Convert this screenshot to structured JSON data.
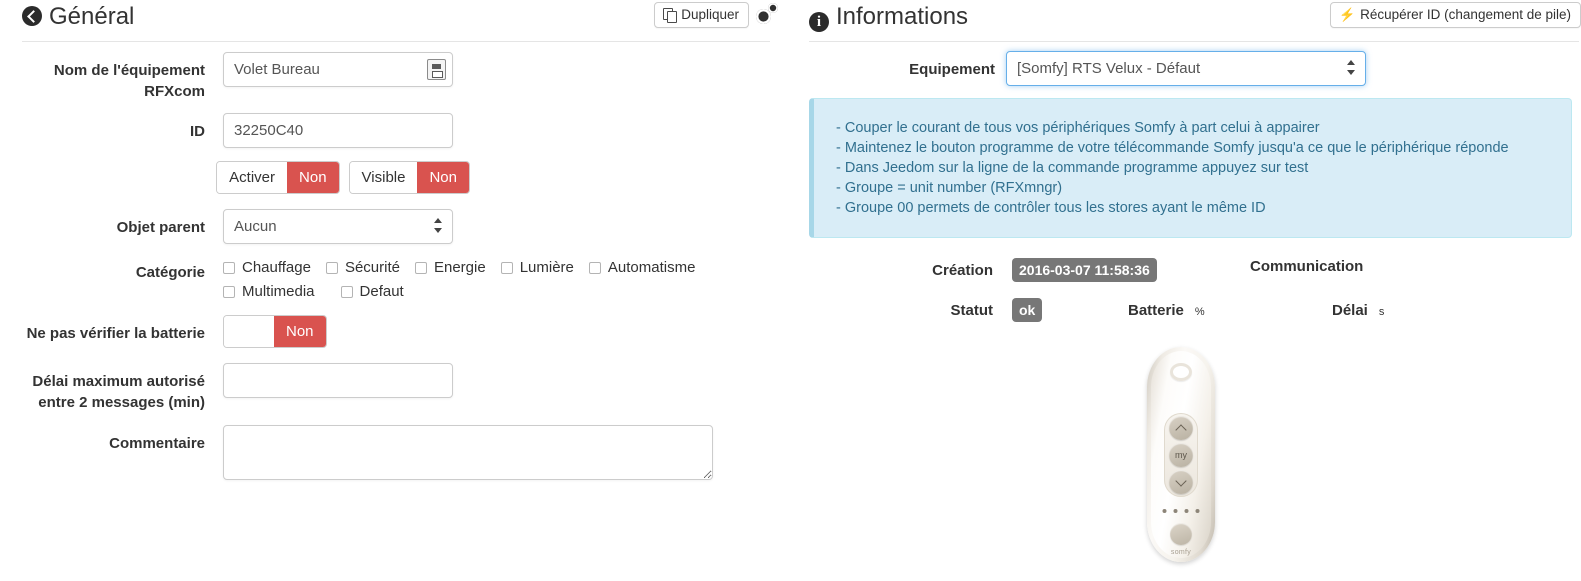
{
  "left_panel": {
    "title": "Général",
    "back_icon": "back-arrow-icon",
    "duplicate_button": "Dupliquer",
    "duplicate_icon": "copy-icon",
    "config_icon": "gears-icon",
    "fields": {
      "name_label": "Nom de l'équipement RFXcom",
      "name_label_line1": "Nom de l'équipement",
      "name_label_line2": "RFXcom",
      "name_value": "Volet Bureau",
      "name_inline_icon": "battery-picker-icon",
      "id_label": "ID",
      "id_value": "32250C40",
      "parent_label": "Objet parent",
      "parent_value": "Aucun",
      "category_label": "Catégorie",
      "battery_check_label": "Ne pas vérifier la batterie",
      "delay_label_line1": "Délai maximum autorisé",
      "delay_label_line2": "entre 2 messages (min)",
      "delay_value": "",
      "comment_label": "Commentaire",
      "comment_value": ""
    },
    "toggles": [
      {
        "name": "activer",
        "label": "Activer",
        "state": "Non"
      },
      {
        "name": "visible",
        "label": "Visible",
        "state": "Non"
      }
    ],
    "battery_toggle": {
      "label": "",
      "state": "Non"
    },
    "categories": [
      {
        "label": "Chauffage",
        "checked": false
      },
      {
        "label": "Sécurité",
        "checked": false
      },
      {
        "label": "Energie",
        "checked": false
      },
      {
        "label": "Lumière",
        "checked": false
      },
      {
        "label": "Automatisme",
        "checked": false
      },
      {
        "label": "Multimedia",
        "checked": false
      },
      {
        "label": "Defaut",
        "checked": false
      }
    ]
  },
  "right_panel": {
    "title": "Informations",
    "info_icon": "info-circle-icon",
    "recover_button": "Récupérer ID (changement de pile)",
    "recover_icon": "bolt-icon",
    "equipment_label": "Equipement",
    "equipment_value": "[Somfy] RTS Velux - Défaut",
    "alert_lines": [
      "- Couper le courant de tous vos périphériques Somfy à part celui à appairer",
      "- Maintenez le bouton programme de votre télécommande Somfy jusqu'a ce que le périphérique réponde",
      "- Dans Jeedom sur la ligne de la commande programme appuyez sur test",
      "- Groupe = unit number (RFXmngr)",
      "- Groupe 00 permets de contrôler tous les stores ayant le même ID"
    ],
    "status": {
      "creation_label": "Création",
      "creation_value": "2016-03-07 11:58:36",
      "communication_label": "Communication",
      "communication_value": "",
      "statut_label": "Statut",
      "statut_value": "ok",
      "batterie_label": "Batterie",
      "batterie_value": "",
      "batterie_unit": "%",
      "delai_label": "Délai",
      "delai_value": "",
      "delai_unit": "s"
    },
    "device_image": {
      "name": "somfy-telis-remote-image",
      "my_button_label": "my",
      "brand_label": "somfy"
    }
  },
  "colors": {
    "danger": "#d9534f",
    "info_bg": "#d9edf7",
    "info_text": "#31708f",
    "badge_gray": "#777777",
    "focus_blue": "#66afe9"
  }
}
